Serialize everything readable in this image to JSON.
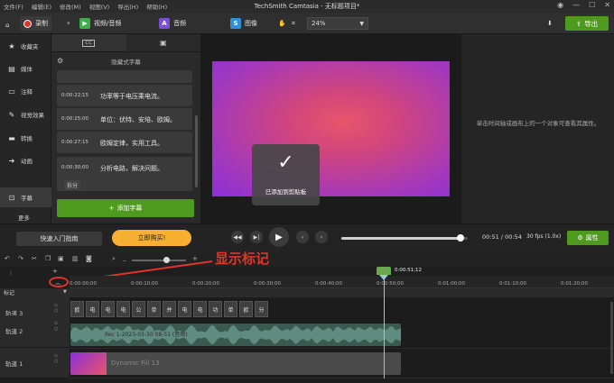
{
  "menu": [
    "文件(F)",
    "编辑(E)",
    "修改(M)",
    "视图(V)",
    "导出(H)",
    "帮助(H)"
  ],
  "app_title": "TechSmith Camtasia - 无标题项目*",
  "toolbar": {
    "record_label": "录制",
    "video_audio_label": "视频/音频",
    "audio_label": "音频",
    "image_label": "图像",
    "zoom_value": "24%",
    "export_label": "导出"
  },
  "sidebar": {
    "items": [
      {
        "label": "收藏夹",
        "icon": "star-icon"
      },
      {
        "label": "媒体",
        "icon": "media-icon"
      },
      {
        "label": "注释",
        "icon": "annotation-icon"
      },
      {
        "label": "视觉效果",
        "icon": "visual-effects-icon"
      },
      {
        "label": "转换",
        "icon": "transition-icon"
      },
      {
        "label": "动画",
        "icon": "animation-icon"
      },
      {
        "label": "字幕",
        "icon": "captions-icon"
      }
    ],
    "more_label": "更多"
  },
  "captions_panel": {
    "header": "隐藏式字幕",
    "items": [
      {
        "time": "",
        "text": ""
      },
      {
        "time": "0:00:22;15",
        "text": "功率等于电压乘电流。"
      },
      {
        "time": "0:00:25;00",
        "text": "单位：伏特、安培、欧姆。"
      },
      {
        "time": "0:00:27;15",
        "text": "欧姆定律，实用工具。"
      },
      {
        "time": "0:00:30;00",
        "text": "分析电路，解决问题。"
      }
    ],
    "split_label": "拆分",
    "add_label": "添加字幕"
  },
  "canvas": {
    "toast_message": "已添加到剪贴板"
  },
  "properties": {
    "empty_message": "单击时间轴或画布上的一个对象可查看其属性。"
  },
  "playback": {
    "guide_label": "快速入门指南",
    "buy_label": "立即购买!",
    "time_current": "00:51",
    "time_total": "00:54",
    "fps": "30 fps (1.0x)",
    "properties_label": "属性",
    "progress_fraction": 0.944
  },
  "annotation": {
    "text": "显示标记"
  },
  "timeline": {
    "playhead_time": "0:00:51;12",
    "ruler_ticks": [
      "0:00:00;00",
      "0:00:10;00",
      "0:00:20;00",
      "0:00:30;00",
      "0:00:40;00",
      "0:00:50;00",
      "0:01:00;00",
      "0:01:10;00",
      "0:01:20;00"
    ],
    "marker_label": "标记",
    "tracks": [
      {
        "name": "轨道 3"
      },
      {
        "name": "轨道 2"
      },
      {
        "name": "轨道 1"
      }
    ],
    "caption_clips": [
      "欧",
      "电",
      "电",
      "电",
      "公",
      "单",
      "并",
      "电",
      "电",
      "功",
      "单",
      "欧",
      "分"
    ],
    "audio_clip_label": "Rec 1-2023-03-30 08-51 (音频)",
    "video_clip_label": "Dynamic Fill 13"
  }
}
